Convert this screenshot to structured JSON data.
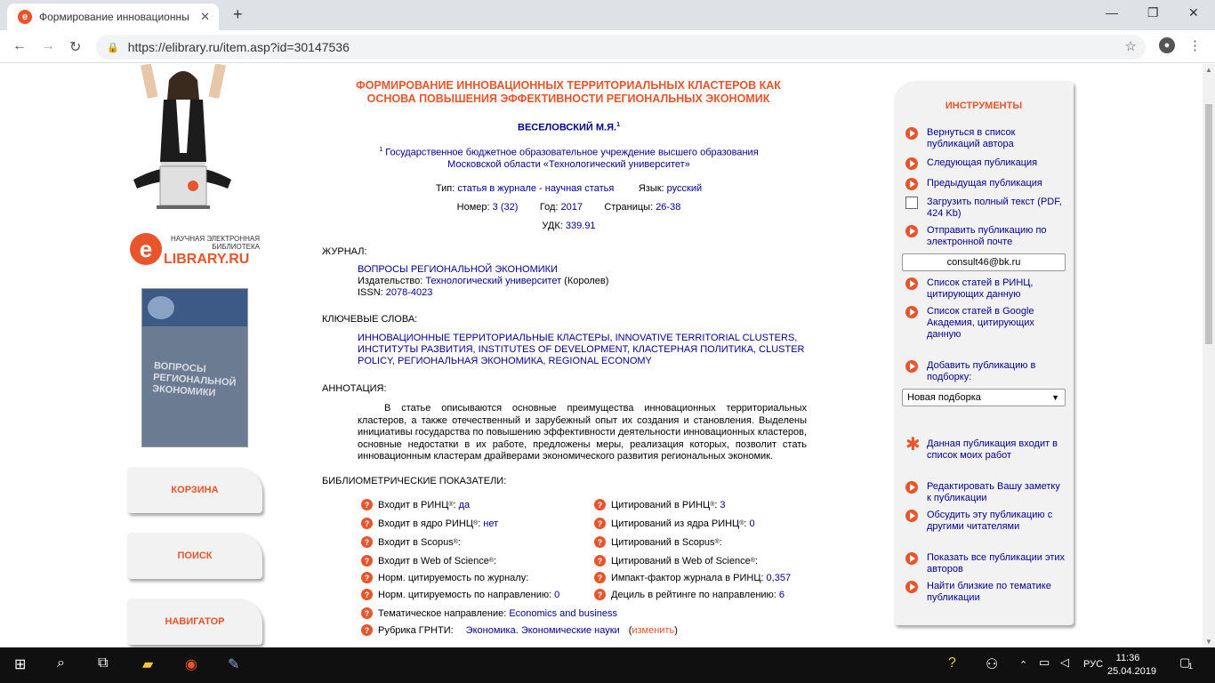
{
  "browser": {
    "tab_title": "Формирование инновационны",
    "url": "https://elibrary.ru/item.asp?id=30147536"
  },
  "left": {
    "logo_top": "НАУЧНАЯ ЭЛЕКТРОННАЯ БИБЛИОТЕКА",
    "logo_main": "LIBRARY.RU",
    "logo_e": "e",
    "cover_title": "ВОПРОСЫ РЕГИОНАЛЬНОЙ ЭКОНОМИКИ",
    "buttons": [
      "КОРЗИНА",
      "ПОИСК",
      "НАВИГАТОР"
    ]
  },
  "article": {
    "title": "ФОРМИРОВАНИЕ ИННОВАЦИОННЫХ ТЕРРИТОРИАЛЬНЫХ КЛАСТЕРОВ КАК ОСНОВА ПОВЫШЕНИЯ ЭФФЕКТИВНОСТИ РЕГИОНАЛЬНЫХ ЭКОНОМИК",
    "author": "ВЕСЕЛОВСКИЙ М.Я.",
    "author_sup": "1",
    "affil_sup": "1",
    "affiliation": "Государственное бюджетное образовательное учреждение высшего образования Московской области «Технологический университет»",
    "type_label": "Тип:",
    "type_value": "статья в журнале - научная статья",
    "lang_label": "Язык:",
    "lang_value": "русский",
    "number_label": "Номер:",
    "number_value": "3 (32)",
    "year_label": "Год:",
    "year_value": "2017",
    "pages_label": "Страницы:",
    "pages_value": "26-38",
    "udk_label": "УДК:",
    "udk_value": "339.91",
    "journal_heading": "ЖУРНАЛ:",
    "journal_name": "ВОПРОСЫ РЕГИОНАЛЬНОЙ ЭКОНОМИКИ",
    "publisher_label": "Издательство:",
    "publisher_value": "Технологический университет",
    "publisher_city": "(Королев)",
    "issn_label": "ISSN:",
    "issn_value": "2078-4023",
    "keywords_heading": "КЛЮЧЕВЫЕ СЛОВА:",
    "keywords": "ИННОВАЦИОННЫЕ ТЕРРИТОРИАЛЬНЫЕ КЛАСТЕРЫ, INNOVATIVE TERRITORIAL CLUSTERS, ИНСТИТУТЫ РАЗВИТИЯ, INSTITUTES OF DEVELOPMENT, КЛАСТЕРНАЯ ПОЛИТИКА, CLUSTER POLICY, РЕГИОНАЛЬНАЯ ЭКОНОМИКА, REGIONAL ECONOMY",
    "abstract_heading": "АННОТАЦИЯ:",
    "abstract": "В статье описываются основные преимущества инновационных территориальных кластеров, а также отечественный и зарубежный опыт их создания и становления. Выделены инициативы государства по повышению эффективности деятельности инновационных кластеров, основные недостатки в их работе, предложены меры, реализация которых, позволит стать инновационным кластерам драйверами экономического развития региональных экономик.",
    "biblio_heading": "БИБЛИОМЕТРИЧЕСКИЕ ПОКАЗАТЕЛИ:"
  },
  "biblio": [
    {
      "label": "Входит в РИНЦ",
      "sup": "®",
      "colon": ":",
      "value": "да"
    },
    {
      "label": "Цитирований в РИНЦ",
      "sup": "®",
      "colon": ":",
      "value": "3"
    },
    {
      "label": "Входит в ядро РИНЦ",
      "sup": "®",
      "colon": ":",
      "value": "нет"
    },
    {
      "label": "Цитирований из ядра РИНЦ",
      "sup": "®",
      "colon": ":",
      "value": "0"
    },
    {
      "label": "Входит в Scopus",
      "sup": "®",
      "colon": ":",
      "value": ""
    },
    {
      "label": "Цитирований в Scopus",
      "sup": "®",
      "colon": ":",
      "value": ""
    },
    {
      "label": "Входит в Web of Science",
      "sup": "®",
      "colon": ":",
      "value": ""
    },
    {
      "label": "Цитирований в Web of Science",
      "sup": "®",
      "colon": ":",
      "value": ""
    },
    {
      "label": "Норм. цитируемость по журналу:",
      "sup": "",
      "colon": "",
      "value": ""
    },
    {
      "label": "Импакт-фактор журнала в РИНЦ:",
      "sup": "",
      "colon": "",
      "value": "0,357"
    },
    {
      "label": "Норм. цитируемость по направлению:",
      "sup": "",
      "colon": "",
      "value": "0"
    },
    {
      "label": "Дециль в рейтинге по направлению:",
      "sup": "",
      "colon": "",
      "value": "6"
    },
    {
      "label": "Тематическое направление:",
      "sup": "",
      "colon": "",
      "value": "Economics and business"
    },
    {
      "label": "Рубрика ГРНТИ:",
      "sup": "",
      "colon": "",
      "value": "Экономика. Экономические науки"
    }
  ],
  "change_link": "изменить",
  "tools": {
    "heading": "ИНСТРУМЕНТЫ",
    "items": [
      "Вернуться в список публикаций автора",
      "Следующая публикация",
      "Предыдущая публикация",
      "Загрузить полный текст (PDF, 424 Kb)",
      "Отправить публикацию по электронной почте",
      "Список статей в РИНЦ, цитирующих данную",
      "Список статей в Google Академия, цитирующих данную",
      "Добавить публикацию в подборку:",
      "Данная публикация входит в список моих работ",
      "Редактировать Вашу заметку к публикации",
      "Обсудить эту публикацию с другими читателями",
      "Показать все публикации этих авторов",
      "Найти близкие по тематике публикации"
    ],
    "email": "consult46@bk.ru",
    "select_value": "Новая подборка"
  },
  "taskbar": {
    "lang": "РУС",
    "time": "11:36",
    "date": "25.04.2019",
    "notif_count": "1"
  }
}
